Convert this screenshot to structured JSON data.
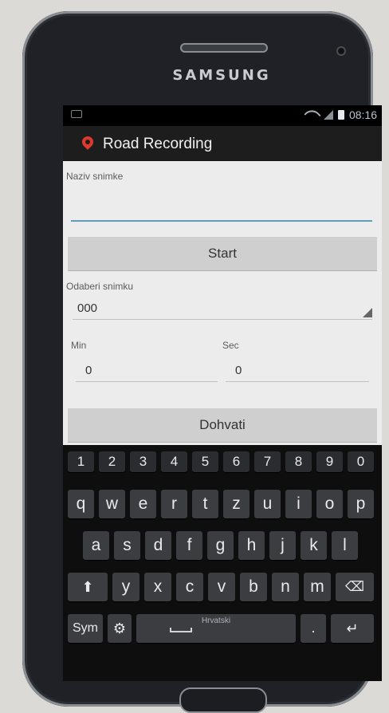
{
  "device": {
    "brand": "SAMSUNG"
  },
  "status_bar": {
    "time": "08:16"
  },
  "app": {
    "title": "Road Recording",
    "accent": "#e0392c"
  },
  "form": {
    "name_label": "Naziv snimke",
    "name_value": "",
    "start_button": "Start",
    "select_label": "Odaberi snimku",
    "select_value": "000",
    "min_label": "Min",
    "sec_label": "Sec",
    "min_value": "0",
    "sec_value": "0",
    "fetch_button": "Dohvati"
  },
  "keyboard": {
    "numbers": [
      "1",
      "2",
      "3",
      "4",
      "5",
      "6",
      "7",
      "8",
      "9",
      "0"
    ],
    "row1": [
      "q",
      "w",
      "e",
      "r",
      "t",
      "z",
      "u",
      "i",
      "o",
      "p"
    ],
    "row2": [
      "a",
      "s",
      "d",
      "f",
      "g",
      "h",
      "j",
      "k",
      "l"
    ],
    "row3": [
      "y",
      "x",
      "c",
      "v",
      "b",
      "n",
      "m"
    ],
    "sym": "Sym",
    "space_label": "Hrvatski",
    "dot": "."
  }
}
